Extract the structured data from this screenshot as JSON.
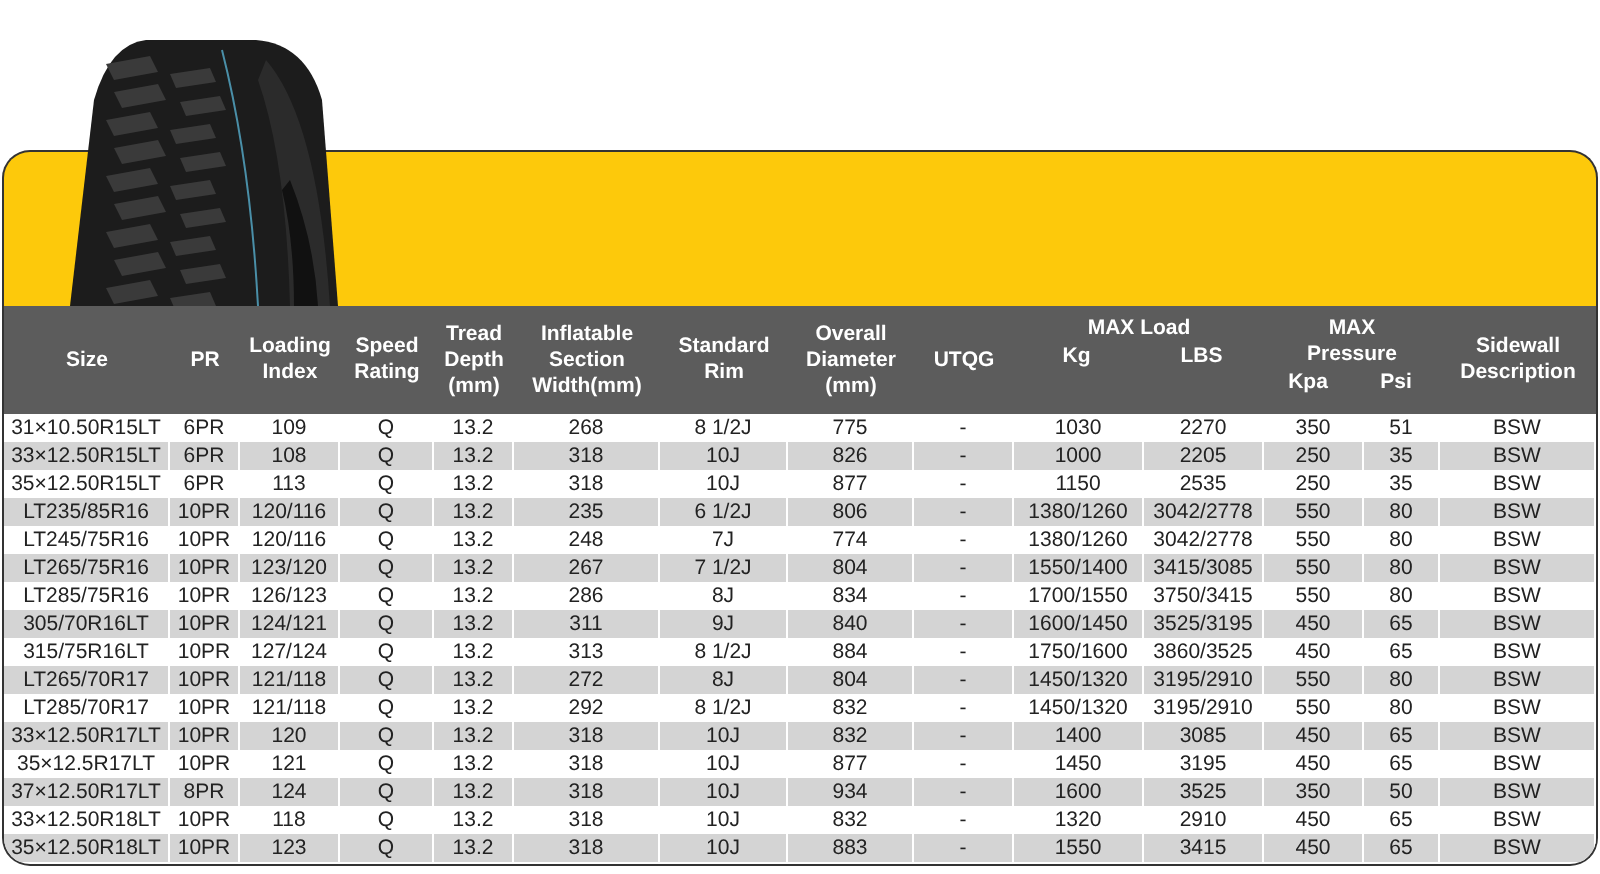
{
  "table": {
    "columns": [
      {
        "lines": [
          "Size"
        ]
      },
      {
        "lines": [
          "PR"
        ]
      },
      {
        "lines": [
          "Loading",
          "Index"
        ]
      },
      {
        "lines": [
          "Speed",
          "Rating"
        ]
      },
      {
        "lines": [
          "Tread",
          "Depth",
          "(mm)"
        ]
      },
      {
        "lines": [
          "Inflatable",
          "Section",
          "Width(mm)"
        ]
      },
      {
        "lines": [
          "Standard",
          "Rim"
        ]
      },
      {
        "lines": [
          "Overall",
          "Diameter",
          "(mm)"
        ]
      },
      {
        "lines": [
          "UTQG"
        ]
      },
      {
        "lines": [
          "Kg"
        ],
        "group": {
          "lines": [
            "MAX Load"
          ]
        }
      },
      {
        "lines": [
          "LBS"
        ],
        "in_group": true
      },
      {
        "lines": [
          "Kpa"
        ],
        "group": {
          "lines": [
            "MAX",
            "Pressure"
          ]
        }
      },
      {
        "lines": [
          "Psi"
        ],
        "in_group": true
      },
      {
        "lines": [
          "Sidewall",
          "Description"
        ]
      }
    ],
    "rows": [
      [
        "31×10.50R15LT",
        "6PR",
        "109",
        "Q",
        "13.2",
        "268",
        "8 1/2J",
        "775",
        "-",
        "1030",
        "2270",
        "350",
        "51",
        "BSW"
      ],
      [
        "33×12.50R15LT",
        "6PR",
        "108",
        "Q",
        "13.2",
        "318",
        "10J",
        "826",
        "-",
        "1000",
        "2205",
        "250",
        "35",
        "BSW"
      ],
      [
        "35×12.50R15LT",
        "6PR",
        "113",
        "Q",
        "13.2",
        "318",
        "10J",
        "877",
        "-",
        "1150",
        "2535",
        "250",
        "35",
        "BSW"
      ],
      [
        "LT235/85R16",
        "10PR",
        "120/116",
        "Q",
        "13.2",
        "235",
        "6 1/2J",
        "806",
        "-",
        "1380/1260",
        "3042/2778",
        "550",
        "80",
        "BSW"
      ],
      [
        "LT245/75R16",
        "10PR",
        "120/116",
        "Q",
        "13.2",
        "248",
        "7J",
        "774",
        "-",
        "1380/1260",
        "3042/2778",
        "550",
        "80",
        "BSW"
      ],
      [
        "LT265/75R16",
        "10PR",
        "123/120",
        "Q",
        "13.2",
        "267",
        "7 1/2J",
        "804",
        "-",
        "1550/1400",
        "3415/3085",
        "550",
        "80",
        "BSW"
      ],
      [
        "LT285/75R16",
        "10PR",
        "126/123",
        "Q",
        "13.2",
        "286",
        "8J",
        "834",
        "-",
        "1700/1550",
        "3750/3415",
        "550",
        "80",
        "BSW"
      ],
      [
        "305/70R16LT",
        "10PR",
        "124/121",
        "Q",
        "13.2",
        "311",
        "9J",
        "840",
        "-",
        "1600/1450",
        "3525/3195",
        "450",
        "65",
        "BSW"
      ],
      [
        "315/75R16LT",
        "10PR",
        "127/124",
        "Q",
        "13.2",
        "313",
        "8 1/2J",
        "884",
        "-",
        "1750/1600",
        "3860/3525",
        "450",
        "65",
        "BSW"
      ],
      [
        "LT265/70R17",
        "10PR",
        "121/118",
        "Q",
        "13.2",
        "272",
        "8J",
        "804",
        "-",
        "1450/1320",
        "3195/2910",
        "550",
        "80",
        "BSW"
      ],
      [
        "LT285/70R17",
        "10PR",
        "121/118",
        "Q",
        "13.2",
        "292",
        "8 1/2J",
        "832",
        "-",
        "1450/1320",
        "3195/2910",
        "550",
        "80",
        "BSW"
      ],
      [
        "33×12.50R17LT",
        "10PR",
        "120",
        "Q",
        "13.2",
        "318",
        "10J",
        "832",
        "-",
        "1400",
        "3085",
        "450",
        "65",
        "BSW"
      ],
      [
        "35×12.5R17LT",
        "10PR",
        "121",
        "Q",
        "13.2",
        "318",
        "10J",
        "877",
        "-",
        "1450",
        "3195",
        "450",
        "65",
        "BSW"
      ],
      [
        "37×12.50R17LT",
        "8PR",
        "124",
        "Q",
        "13.2",
        "318",
        "10J",
        "934",
        "-",
        "1600",
        "3525",
        "350",
        "50",
        "BSW"
      ],
      [
        "33×12.50R18LT",
        "10PR",
        "118",
        "Q",
        "13.2",
        "318",
        "10J",
        "832",
        "-",
        "1320",
        "2910",
        "450",
        "65",
        "BSW"
      ],
      [
        "35×12.50R18LT",
        "10PR",
        "123",
        "Q",
        "13.2",
        "318",
        "10J",
        "883",
        "-",
        "1550",
        "3415",
        "450",
        "65",
        "BSW"
      ]
    ]
  }
}
